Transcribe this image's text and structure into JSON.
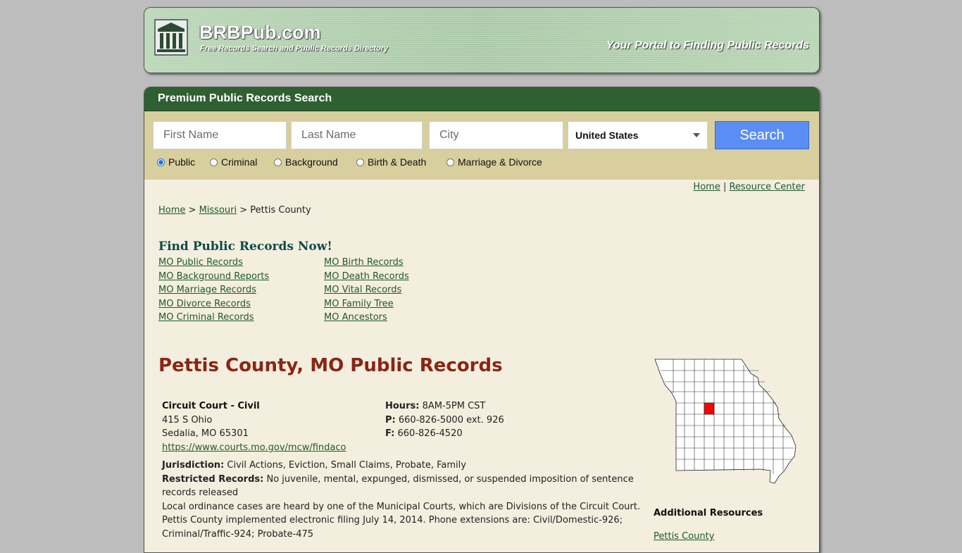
{
  "header": {
    "site_name": "BRBPub.com",
    "subtitle": "Free Records Search and Public Records Directory",
    "tagline": "Your Portal to Finding Public Records"
  },
  "search": {
    "title": "Premium Public Records Search",
    "first_name_placeholder": "First Name",
    "last_name_placeholder": "Last Name",
    "city_placeholder": "City",
    "country_selected": "United States",
    "button_label": "Search",
    "record_types": [
      {
        "label": "Public",
        "selected": true
      },
      {
        "label": "Criminal",
        "selected": false
      },
      {
        "label": "Background",
        "selected": false
      },
      {
        "label": "Birth & Death",
        "selected": false
      },
      {
        "label": "Marriage & Divorce",
        "selected": false
      }
    ]
  },
  "toplinks": {
    "home": "Home",
    "separator": "|",
    "resource_center": "Resource Center"
  },
  "breadcrumb": {
    "home": "Home",
    "sep": ">",
    "state": "Missouri",
    "current": "Pettis County"
  },
  "find": {
    "title": "Find Public Records Now!",
    "left_links": [
      "MO Public Records",
      "MO Background Reports",
      "MO Marriage Records",
      "MO Divorce Records",
      "MO Criminal Records"
    ],
    "right_links": [
      "MO Birth Records",
      "MO Death Records",
      "MO Vital Records",
      "MO Family Tree",
      "MO Ancestors"
    ]
  },
  "county": {
    "title": "Pettis County, MO Public Records",
    "court_name": "Circuit Court - Civil",
    "address1": "415 S Ohio",
    "address2": "Sedalia, MO 65301",
    "url": "https://www.courts.mo.gov/mcw/findaco",
    "hours_label": "Hours:",
    "hours": "8AM-5PM CST",
    "phone_label": "P:",
    "phone": "660-826-5000 ext. 926",
    "fax_label": "F:",
    "fax": "660-826-4520",
    "jurisdiction_label": "Jurisdiction:",
    "jurisdiction": "Civil Actions, Eviction, Small Claims, Probate, Family",
    "restricted_label": "Restricted Records:",
    "restricted": "No juvenile, mental, expunged, dismissed, or suspended imposition of sentence records released",
    "notes": "Local ordinance cases are heard by one of the Municipal Courts, which are Divisions of the Circuit Court. Pettis County implemented electronic filing July 14, 2014. Phone extensions are: Civil/Domestic-926; Criminal/Traffic-924; Probate-475"
  },
  "sidebar": {
    "additional_title": "Additional Resources",
    "link": "Pettis County",
    "highlight_color": "#ff0000"
  }
}
